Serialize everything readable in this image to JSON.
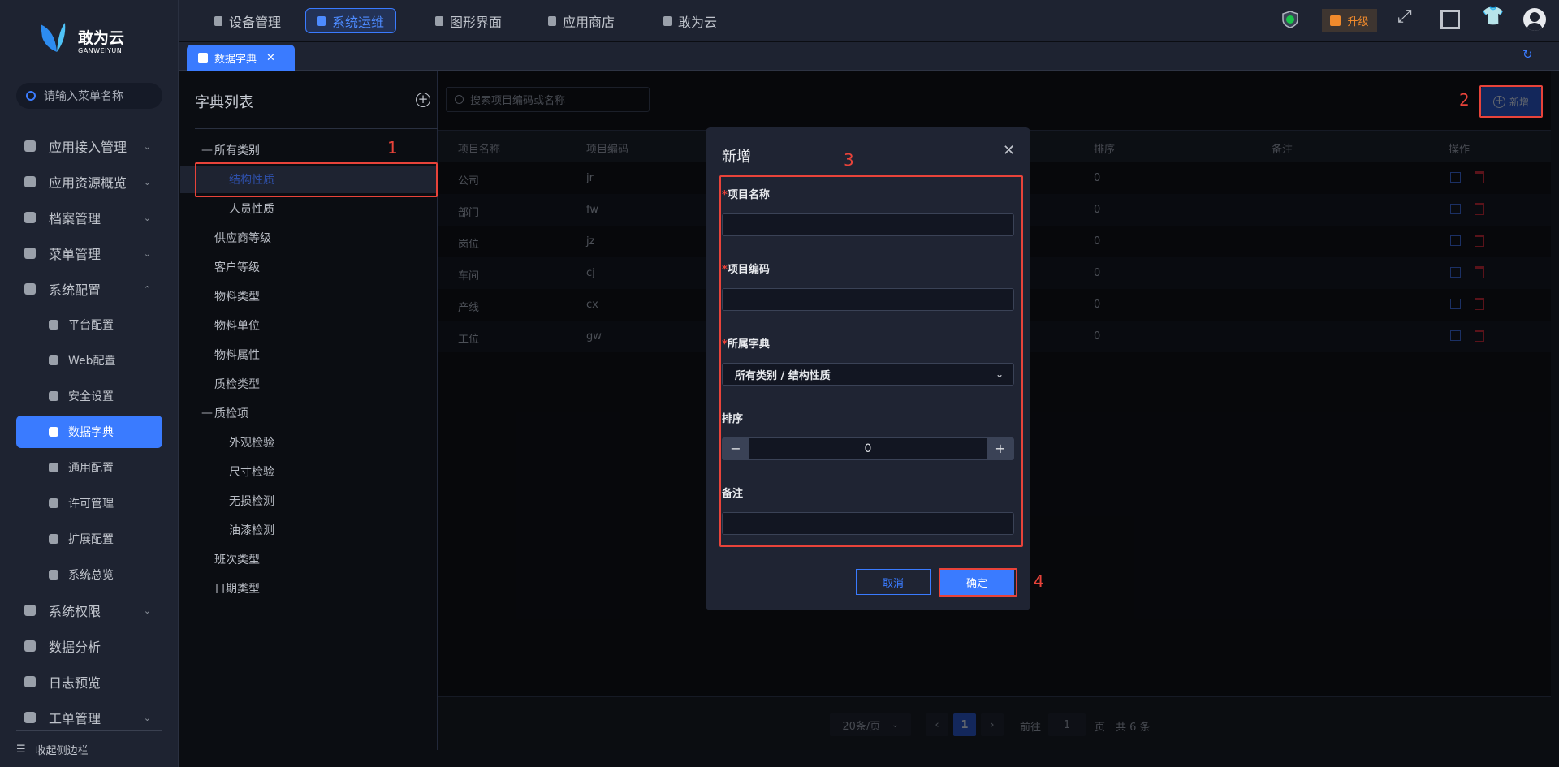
{
  "brand": {
    "name": "敢为云",
    "sub": "GANWEIYUN"
  },
  "sidebar": {
    "search_placeholder": "请输入菜单名称",
    "items": [
      {
        "label": "应用接入管理",
        "chev": "⌄"
      },
      {
        "label": "应用资源概览",
        "chev": "⌄"
      },
      {
        "label": "档案管理",
        "chev": "⌄"
      },
      {
        "label": "菜单管理",
        "chev": "⌄"
      },
      {
        "label": "系统配置",
        "chev": "⌃"
      },
      {
        "label": "平台配置"
      },
      {
        "label": "Web配置"
      },
      {
        "label": "安全设置"
      },
      {
        "label": "数据字典"
      },
      {
        "label": "通用配置"
      },
      {
        "label": "许可管理"
      },
      {
        "label": "扩展配置"
      },
      {
        "label": "系统总览"
      },
      {
        "label": "系统权限",
        "chev": "⌄"
      },
      {
        "label": "数据分析"
      },
      {
        "label": "日志预览"
      },
      {
        "label": "工单管理",
        "chev": "⌄"
      }
    ],
    "collapse": "收起侧边栏"
  },
  "topnav": [
    {
      "label": "设备管理"
    },
    {
      "label": "系统运维"
    },
    {
      "label": "图形界面"
    },
    {
      "label": "应用商店"
    },
    {
      "label": "敢为云"
    }
  ],
  "upgrade": "升级",
  "tab": {
    "label": "数据字典",
    "close": "✕"
  },
  "tree": {
    "title": "字典列表",
    "items": [
      {
        "label": "所有类别",
        "level": 0,
        "expanded": true
      },
      {
        "label": "结构性质",
        "level": 1,
        "selected": true
      },
      {
        "label": "人员性质",
        "level": 1
      },
      {
        "label": "供应商等级",
        "level": 0
      },
      {
        "label": "客户等级",
        "level": 0
      },
      {
        "label": "物料类型",
        "level": 0
      },
      {
        "label": "物料单位",
        "level": 0
      },
      {
        "label": "物料属性",
        "level": 0
      },
      {
        "label": "质检类型",
        "level": 0
      },
      {
        "label": "质检项",
        "level": 0,
        "expanded": true
      },
      {
        "label": "外观检验",
        "level": 1
      },
      {
        "label": "尺寸检验",
        "level": 1
      },
      {
        "label": "无损检测",
        "level": 1
      },
      {
        "label": "油漆检测",
        "level": 1
      },
      {
        "label": "班次类型",
        "level": 0
      },
      {
        "label": "日期类型",
        "level": 0
      }
    ]
  },
  "main": {
    "search_placeholder": "搜索项目编码或名称",
    "add_label": "新增",
    "columns": [
      "项目名称",
      "项目编码",
      "排序",
      "备注",
      "操作"
    ],
    "rows": [
      [
        "公司",
        "jr",
        "0"
      ],
      [
        "部门",
        "fw",
        "0"
      ],
      [
        "岗位",
        "jz",
        "0"
      ],
      [
        "车间",
        "cj",
        "0"
      ],
      [
        "产线",
        "cx",
        "0"
      ],
      [
        "工位",
        "gw",
        "0"
      ]
    ],
    "pager": {
      "page_size": "20条/页",
      "current": "1",
      "goto": "前往",
      "goto_value": "1",
      "page_unit": "页",
      "total": "共 6 条"
    }
  },
  "modal": {
    "title": "新增",
    "fields": {
      "name": "项目名称",
      "code": "项目编码",
      "dict": "所属字典",
      "dict_value": "所有类别 / 结构性质",
      "order": "排序",
      "order_value": "0",
      "remark": "备注"
    },
    "cancel": "取消",
    "ok": "确定"
  },
  "annotations": [
    "1",
    "2",
    "3",
    "4"
  ],
  "colors": {
    "accent": "#3a7bff",
    "annotation": "#e8433a"
  }
}
